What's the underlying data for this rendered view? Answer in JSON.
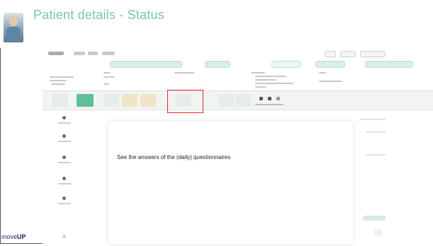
{
  "slide": {
    "title": "Patient details - Status",
    "brand_prefix": "move",
    "brand_suffix": "UP"
  },
  "popup": {
    "text": "See the answers of the (daily) questionnaires"
  },
  "colors": {
    "title": "#7cc6a8",
    "highlight": "#e0282a",
    "accent_green": "#5fbf98"
  }
}
